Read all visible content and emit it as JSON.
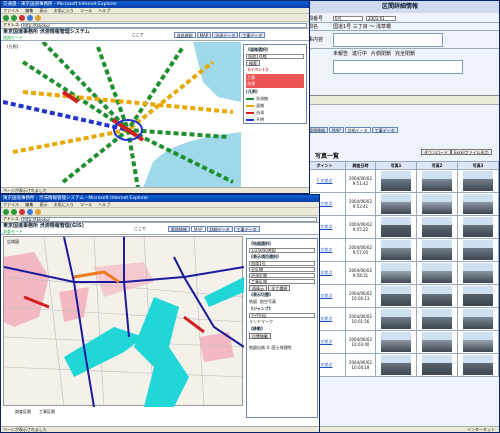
{
  "win1": {
    "title": "交通量 - 東京国道事務所 - Microsoft Internet Explorer",
    "menu": [
      "ファイル",
      "編集",
      "表示",
      "お気に入り",
      "ツール",
      "ヘルプ"
    ],
    "address_label": "アドレス",
    "address": "http://tkkoku/",
    "app_title": "東京国道事務所 渋滞情報管理システム",
    "app_sub": "道路モード",
    "here_label": "ここで",
    "nav": [
      "道路種類",
      "MAP",
      "渋滞データ",
      "工事データ"
    ],
    "map_title": "(凡例)",
    "panel": {
      "hdr1": "《道路選択》",
      "road_select": "国道1号線",
      "search_btn": "検索",
      "hdr2": "《イベント》",
      "event_items": [
        "工事",
        "渋滞"
      ],
      "hdr3": "(凡例)",
      "legend": [
        {
          "label": "渋滞無",
          "color": "#1e8f2e"
        },
        {
          "label": "混雑",
          "color": "#e8a800"
        },
        {
          "label": "渋滞",
          "color": "#d22020"
        },
        {
          "label": "不明",
          "color": "#2233cc"
        }
      ]
    },
    "status": "ページが表示されました"
  },
  "win2": {
    "title": "区間詳細情報",
    "fields": [
      {
        "label": "区間番号",
        "value": "6号",
        "value2": "2003-01"
      },
      {
        "label": "区間名",
        "value": "国道1号 三丁目 ～ 浅草橋"
      },
      {
        "label": "工事内容",
        "value": ""
      }
    ],
    "radio_options": [
      "未報告",
      "進行中",
      "片側閉鎖",
      "完全閉鎖"
    ],
    "nav": [
      "管理情報",
      "MAP",
      "詳細データ",
      "工事データ"
    ],
    "list_title": "写真一覧",
    "download_btn": "ダウンロード",
    "excel_btn": "Excelファイル出力",
    "columns": [
      "ポイント",
      "調査日時",
      "写真1",
      "写真2",
      "写真3"
    ],
    "rows": [
      {
        "point": "1 交差点",
        "date": "2004/06/02",
        "time": "9:51:42"
      },
      {
        "point": "2 交差点",
        "date": "2004/06/02",
        "time": "9:53:41"
      },
      {
        "point": "3 交差点",
        "date": "2004/06/02",
        "time": "9:55:22"
      },
      {
        "point": "4 交差点",
        "date": "2004/06/02",
        "time": "9:57:05"
      },
      {
        "point": "5 交差点",
        "date": "2004/06/02",
        "time": "9:58:31"
      },
      {
        "point": "6 交差点",
        "date": "2004/06/02",
        "time": "10:00:13"
      },
      {
        "point": "7 交差点",
        "date": "2004/06/02",
        "time": "10:01:56"
      },
      {
        "point": "8 交差点",
        "date": "2004/06/02",
        "time": "10:03:40"
      },
      {
        "point": "9 交差点",
        "date": "2004/06/02",
        "time": "10:04:18"
      }
    ],
    "status": "インターネット"
  },
  "win3": {
    "title": "東京国道事務所 - 渋滞情報管理システム - Microsoft Internet Explorer",
    "menu": [
      "ファイル",
      "編集",
      "表示",
      "お気に入り",
      "ツール",
      "ヘルプ"
    ],
    "address_label": "アドレス",
    "address": "http://tkkoku/",
    "app_title": "東京国道事務所 渋滞情報管理(GIS)",
    "app_sub": "調査モード",
    "here_label": "ここで",
    "nav": [
      "管理情報",
      "MAP",
      "詳細データ",
      "工事データ"
    ],
    "map_title": "広域図",
    "panel": {
      "hdr1": "《地図選択》",
      "map_select": "1/25000地図",
      "hdr2": "《表示項目選択》",
      "selects": [
        "国道1号",
        "全区間",
        "渋滞区間",
        "工事区間"
      ],
      "btns": [
        "再表示",
        "全て選択"
      ],
      "hdr3": "《表示切替》",
      "radio_options": [
        "地図",
        "航空写真"
      ],
      "hdr4": "《ジャンプ》",
      "jump_select": "千代田区",
      "jump_label": "ランドマーク",
      "hdr5": "《移動》",
      "move_btn": "位置移動",
      "footer": "地図出典 © 国土地理院"
    },
    "legend_bottom": [
      "調査区間",
      "工事区間"
    ],
    "status": "ページが表示されました"
  },
  "icons": [
    "back-icon",
    "forward-icon",
    "stop-icon",
    "refresh-icon",
    "home-icon"
  ]
}
